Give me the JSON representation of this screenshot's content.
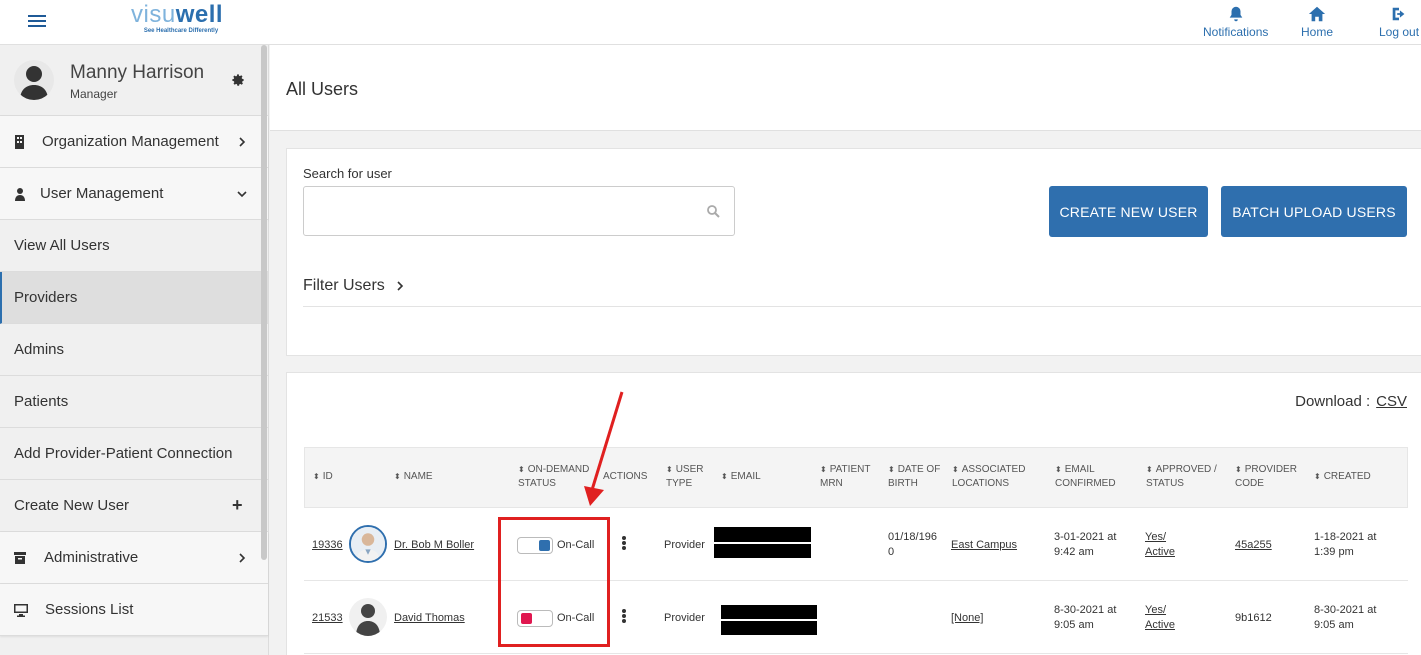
{
  "brand": {
    "word_light": "visu",
    "word_bold": "well",
    "tagline": "See Healthcare Differently"
  },
  "topnav": {
    "notifications": "Notifications",
    "home": "Home",
    "logout": "Log out"
  },
  "profile": {
    "name": "Manny Harrison",
    "role": "Manager"
  },
  "sidebar": {
    "items": [
      {
        "label": "Organization Management"
      },
      {
        "label": "User Management"
      },
      {
        "label": "View All Users"
      },
      {
        "label": "Providers"
      },
      {
        "label": "Admins"
      },
      {
        "label": "Patients"
      },
      {
        "label": "Add Provider-Patient Connection"
      },
      {
        "label": "Create New User"
      },
      {
        "label": "Administrative"
      },
      {
        "label": "Sessions List"
      }
    ]
  },
  "page": {
    "title": "All Users"
  },
  "search": {
    "label": "Search for user",
    "placeholder": ""
  },
  "buttons": {
    "create": "CREATE NEW USER",
    "batch": "BATCH UPLOAD USERS"
  },
  "filter": {
    "label": "Filter Users"
  },
  "download": {
    "label": "Download :",
    "csv": "CSV"
  },
  "table": {
    "headers": {
      "id": "ID",
      "name": "NAME",
      "ondemand_1": "ON-DEMAND",
      "ondemand_2": "STATUS",
      "actions": "ACTIONS",
      "usertype_1": "USER",
      "usertype_2": "TYPE",
      "email": "EMAIL",
      "mrn_1": "PATIENT",
      "mrn_2": "MRN",
      "dob_1": "DATE OF",
      "dob_2": "BIRTH",
      "loc_1": "ASSOCIATED",
      "loc_2": "LOCATIONS",
      "confirmed_1": "EMAIL",
      "confirmed_2": "CONFIRMED",
      "approved_1": "APPROVED /",
      "approved_2": "STATUS",
      "code_1": "PROVIDER",
      "code_2": "CODE",
      "created": "CREATED"
    },
    "rows": [
      {
        "id": "19336",
        "name": "Dr. Bob M Boller",
        "status": "On-Call",
        "status_color": "#2f6fae",
        "type": "Provider",
        "dob_1": "01/18/196",
        "dob_2": "0",
        "location": "East Campus",
        "confirmed_1": "3-01-2021 at",
        "confirmed_2": "9:42 am",
        "approved_1": "Yes/",
        "approved_2": "Active",
        "code": "45a255",
        "created_1": "1-18-2021 at",
        "created_2": "1:39 pm"
      },
      {
        "id": "21533",
        "name": "David Thomas",
        "status": "On-Call",
        "status_color": "#e0174f",
        "type": "Provider",
        "dob_1": "",
        "dob_2": "",
        "location": "[None]",
        "confirmed_1": "8-30-2021 at",
        "confirmed_2": "9:05 am",
        "approved_1": "Yes/",
        "approved_2": "Active",
        "code": "9b1612",
        "created_1": "8-30-2021 at",
        "created_2": "9:05 am"
      }
    ]
  },
  "colors": {
    "accent": "#2f6fae",
    "annotation": "#e02020"
  }
}
